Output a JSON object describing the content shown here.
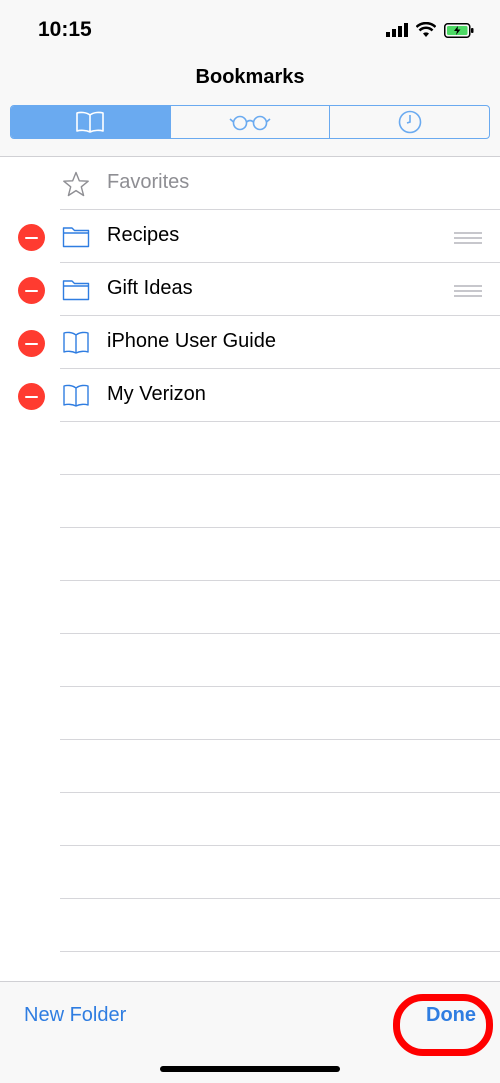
{
  "status_bar": {
    "time": "10:15"
  },
  "nav": {
    "title": "Bookmarks"
  },
  "segments": [
    {
      "icon": "book-icon",
      "active": true
    },
    {
      "icon": "glasses-icon",
      "active": false
    },
    {
      "icon": "clock-icon",
      "active": false
    }
  ],
  "bookmarks": [
    {
      "label": "Favorites",
      "icon": "star-icon",
      "deletable": false,
      "reorderable": false
    },
    {
      "label": "Recipes",
      "icon": "folder-icon",
      "deletable": true,
      "reorderable": true
    },
    {
      "label": "Gift Ideas",
      "icon": "folder-icon",
      "deletable": true,
      "reorderable": true
    },
    {
      "label": "iPhone User Guide",
      "icon": "book-icon",
      "deletable": true,
      "reorderable": false
    },
    {
      "label": "My Verizon",
      "icon": "book-icon",
      "deletable": true,
      "reorderable": false
    }
  ],
  "toolbar": {
    "new_folder_label": "New Folder",
    "done_label": "Done"
  },
  "colors": {
    "accent": "#2f7de1",
    "segment": "#6aaaf0",
    "delete": "#ff3b30",
    "annotation": "#ff0000"
  }
}
